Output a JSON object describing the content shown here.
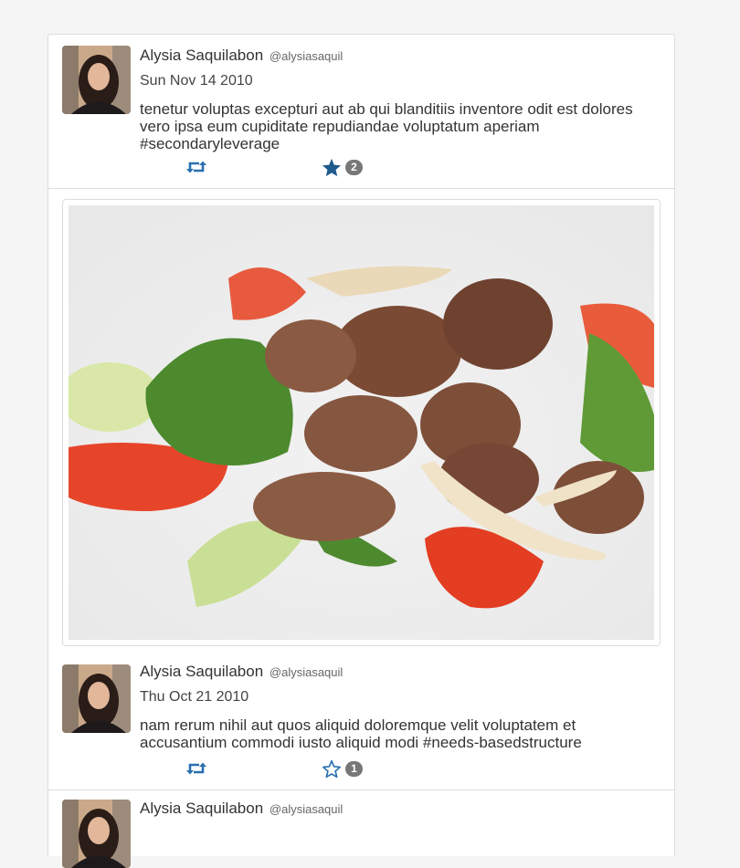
{
  "tweets": [
    {
      "name": "Alysia Saquilabon",
      "handle": "@alysiasaquil",
      "date": "Sun Nov 14 2010",
      "text": "tenetur voluptas excepturi aut ab qui blanditiis inventore odit est dolores vero ipsa eum cupiditate repudiandae voluptatum aperiam #secondaryleverage",
      "favorited": true,
      "fav_count": "2"
    },
    {
      "name": "Alysia Saquilabon",
      "handle": "@alysiasaquil",
      "date": "Thu Oct 21 2010",
      "text": "nam rerum nihil aut quos aliquid doloremque velit voluptatem et accusantium commodi iusto aliquid modi #needs-basedstructure",
      "favorited": false,
      "fav_count": "1"
    },
    {
      "name": "Alysia Saquilabon",
      "handle": "@alysiasaquil"
    }
  ],
  "colors": {
    "action_blue": "#2a6fb0",
    "star_dark": "#1f5a8c",
    "badge_gray": "#777777"
  },
  "icons": {
    "retweet": "retweet-icon",
    "favorite": "star-icon"
  }
}
